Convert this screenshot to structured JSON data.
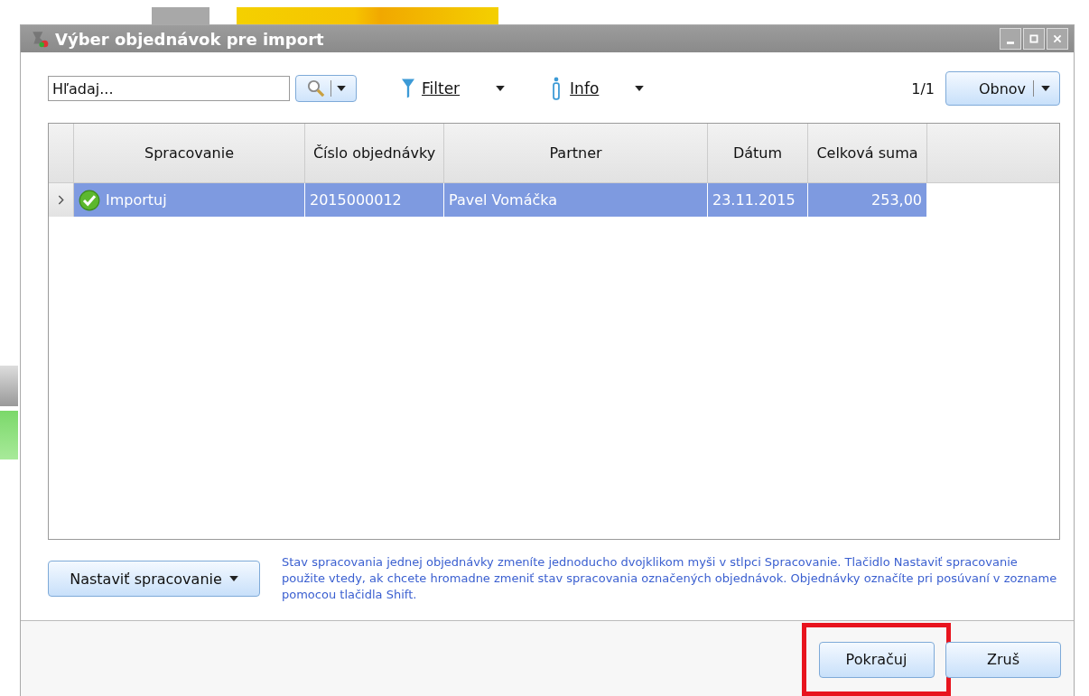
{
  "window": {
    "title": "Výber objednávok pre import"
  },
  "toolbar": {
    "search": {
      "placeholder": "Hľadaj..."
    },
    "filter": "Filter",
    "info": "Info",
    "page": "1/1",
    "refresh": "Obnov"
  },
  "table": {
    "columns": [
      "Spracovanie",
      "Číslo objednávky",
      "Partner",
      "Dátum",
      "Celková suma"
    ],
    "rows": [
      {
        "selected": true,
        "kind": "ok",
        "cells": [
          "Importuj",
          "2015000012",
          "Pavel Vomáčka",
          "23.11.2015",
          "253,00"
        ]
      }
    ]
  },
  "bulk_button": "Nastaviť spracovanie",
  "hint": "Stav spracovania jednej objednávky zmeníte jednoducho dvojklikom myši v stlpci Spracovanie. Tlačidlo Nastaviť spracovanie použite vtedy, ak chcete hromadne zmeniť stav spracovania označených objednávok. Objednávky označíte pri posúvaní v zozname pomocou tlačidla Shift.",
  "buttons": [
    {
      "label": "Pokračuj",
      "highlighted": true
    },
    {
      "label": "Zruš",
      "highlighted": false
    }
  ]
}
